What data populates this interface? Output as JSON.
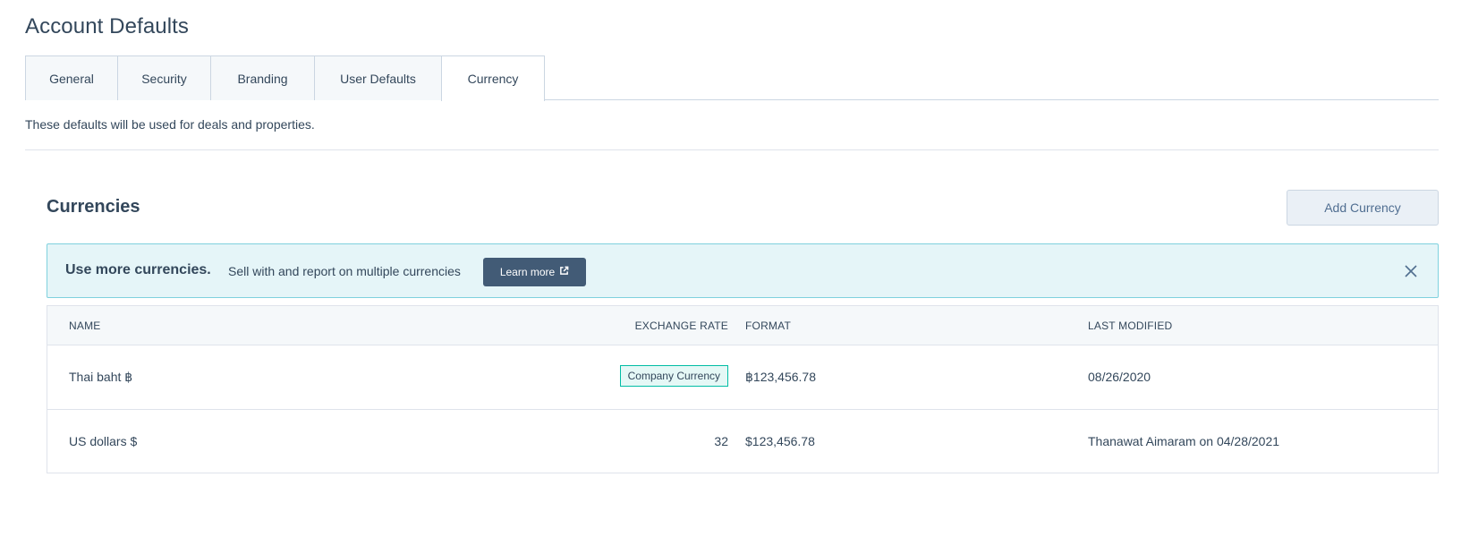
{
  "page": {
    "title": "Account Defaults"
  },
  "tabs": [
    {
      "label": "General"
    },
    {
      "label": "Security"
    },
    {
      "label": "Branding"
    },
    {
      "label": "User Defaults"
    },
    {
      "label": "Currency"
    }
  ],
  "active_tab": "Currency",
  "intro": {
    "text": "These defaults will be used for deals and properties."
  },
  "currencies": {
    "title": "Currencies",
    "add_button": "Add Currency"
  },
  "banner": {
    "title": "Use more currencies.",
    "text": "Sell with and report on multiple currencies",
    "learn_more": "Learn more",
    "external_icon": "external-link-icon",
    "close_icon": "close-icon"
  },
  "table": {
    "headers": {
      "name": "NAME",
      "exchange_rate": "EXCHANGE RATE",
      "format": "FORMAT",
      "last_modified": "LAST MODIFIED"
    },
    "rows": [
      {
        "name": "Thai baht ฿",
        "exchange_rate": "",
        "badge": "Company Currency",
        "format": "฿123,456.78",
        "last_modified": "08/26/2020"
      },
      {
        "name": "US dollars $",
        "exchange_rate": "32",
        "badge": "",
        "format": "$123,456.78",
        "last_modified": "Thanawat Aimaram on 04/28/2021"
      }
    ]
  },
  "colors": {
    "text": "#33475b",
    "banner_bg": "#e5f5f8",
    "banner_border": "#7fd1de",
    "learn_btn_bg": "#425b76",
    "badge_border": "#00bda5"
  }
}
